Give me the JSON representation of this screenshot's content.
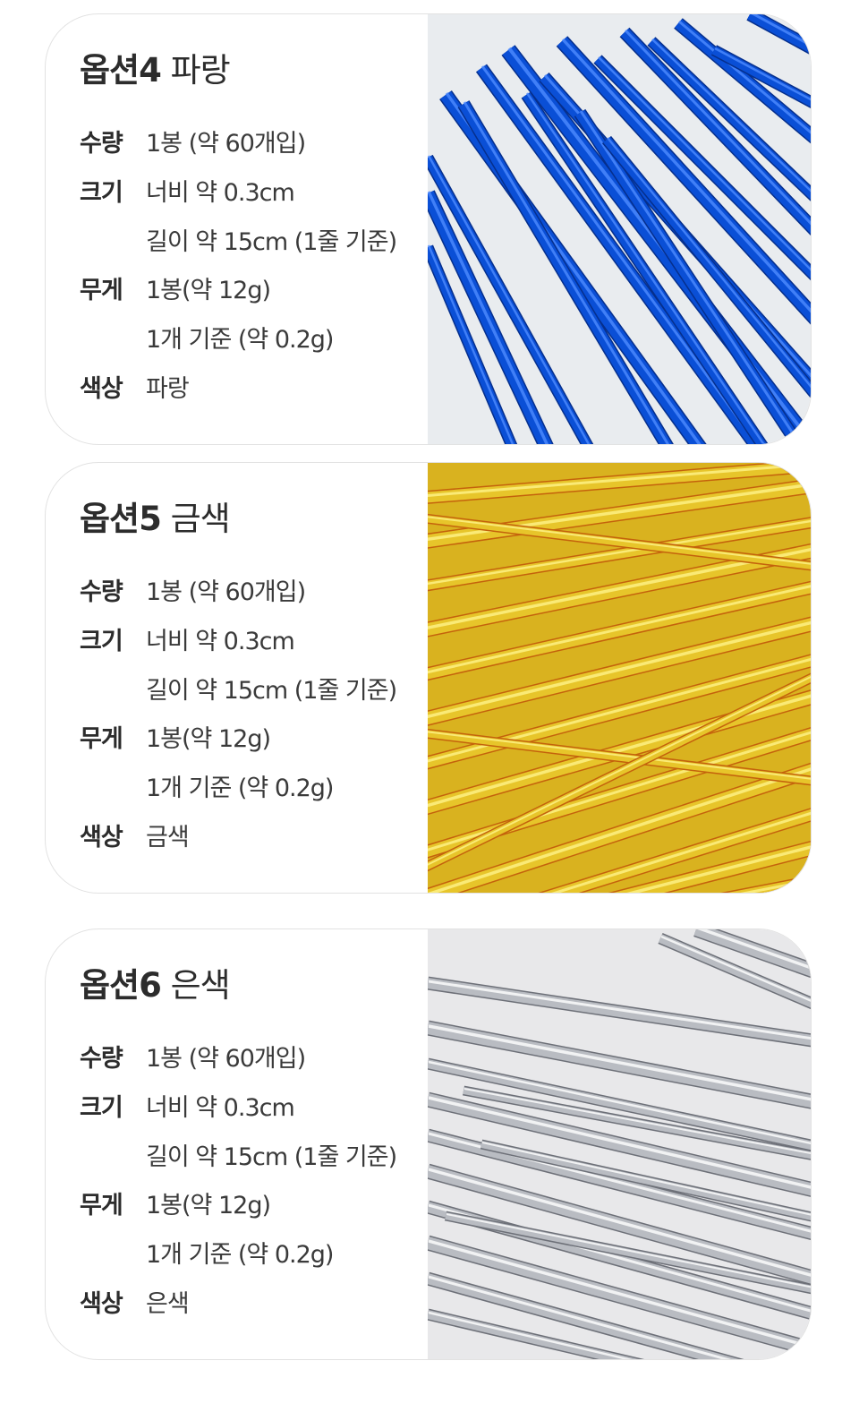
{
  "cards": [
    {
      "option": "옵션4",
      "color_name": "파랑",
      "rows": [
        {
          "label": "수량",
          "value": "1봉 (약 60개입)"
        },
        {
          "label": "크기",
          "value": "너비 약 0.3cm"
        },
        {
          "label": "",
          "value": "길이 약 15cm (1줄 기준)"
        },
        {
          "label": "무게",
          "value": "1봉(약 12g)"
        },
        {
          "label": "",
          "value": "1개 기준 (약 0.2g)"
        },
        {
          "label": "색상",
          "value": "파랑"
        }
      ],
      "photo": {
        "name": "blue-twist-ties-photo",
        "bg": "#e9ecef",
        "stroke": "#0a4fd6",
        "light": "#4d8bff",
        "dark": "#062f8c"
      }
    },
    {
      "option": "옵션5",
      "color_name": "금색",
      "rows": [
        {
          "label": "수량",
          "value": "1봉 (약 60개입)"
        },
        {
          "label": "크기",
          "value": "너비 약 0.3cm"
        },
        {
          "label": "",
          "value": "길이 약 15cm (1줄 기준)"
        },
        {
          "label": "무게",
          "value": "1봉(약 12g)"
        },
        {
          "label": "",
          "value": "1개 기준 (약 0.2g)"
        },
        {
          "label": "색상",
          "value": "금색"
        }
      ],
      "photo": {
        "name": "gold-twist-ties-photo",
        "bg": "#d9b21f",
        "stroke": "#e7c52a",
        "light": "#fff28a",
        "dark": "#c4620c"
      }
    },
    {
      "option": "옵션6",
      "color_name": "은색",
      "rows": [
        {
          "label": "수량",
          "value": "1봉 (약 60개입)"
        },
        {
          "label": "크기",
          "value": "너비 약 0.3cm"
        },
        {
          "label": "",
          "value": "길이 약 15cm (1줄 기준)"
        },
        {
          "label": "무게",
          "value": "1봉(약 12g)"
        },
        {
          "label": "",
          "value": "1개 기준 (약 0.2g)"
        },
        {
          "label": "색상",
          "value": "은색"
        }
      ],
      "photo": {
        "name": "silver-twist-ties-photo",
        "bg": "#e8e8ea",
        "stroke": "#b9bcc2",
        "light": "#ffffff",
        "dark": "#6d7078"
      }
    }
  ]
}
